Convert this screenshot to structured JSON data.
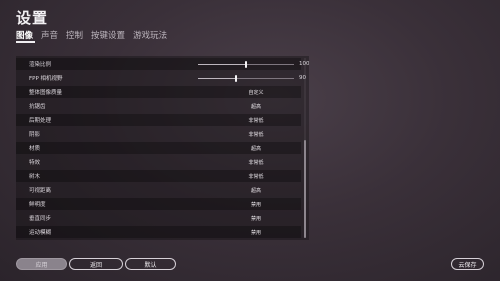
{
  "title": "设置",
  "tabs": [
    {
      "label": "图像",
      "active": true
    },
    {
      "label": "声音",
      "active": false
    },
    {
      "label": "控制",
      "active": false
    },
    {
      "label": "按键设置",
      "active": false
    },
    {
      "label": "游戏玩法",
      "active": false
    }
  ],
  "settings": [
    {
      "label": "渲染比例",
      "type": "slider",
      "value": "100",
      "fraction": 0.5
    },
    {
      "label": "FPP 相机视野",
      "type": "slider",
      "value": "90",
      "fraction": 0.4
    },
    {
      "label": "整体图像质量",
      "type": "option",
      "value": "自定义"
    },
    {
      "label": "抗锯齿",
      "type": "option",
      "value": "超高"
    },
    {
      "label": "后期处理",
      "type": "option",
      "value": "非常低"
    },
    {
      "label": "阴影",
      "type": "option",
      "value": "非常低"
    },
    {
      "label": "材质",
      "type": "option",
      "value": "超高"
    },
    {
      "label": "特效",
      "type": "option",
      "value": "非常低"
    },
    {
      "label": "树木",
      "type": "option",
      "value": "非常低"
    },
    {
      "label": "可视距离",
      "type": "option",
      "value": "超高"
    },
    {
      "label": "鲜明度",
      "type": "option",
      "value": "禁用"
    },
    {
      "label": "垂直同步",
      "type": "option",
      "value": "禁用"
    },
    {
      "label": "运动模糊",
      "type": "option",
      "value": "禁用"
    }
  ],
  "buttons": {
    "apply": "应用",
    "back": "返回",
    "default": "默认",
    "cloud_save": "云保存"
  }
}
